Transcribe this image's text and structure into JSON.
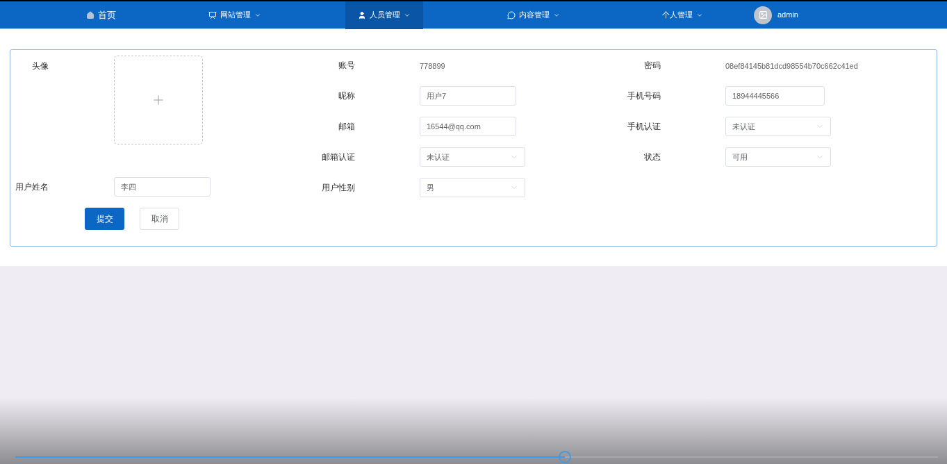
{
  "nav": {
    "items": [
      {
        "label": "首页",
        "dropdown": false,
        "selected": false
      },
      {
        "label": "网站管理",
        "dropdown": true,
        "selected": false
      },
      {
        "label": "人员管理",
        "dropdown": true,
        "selected": true
      },
      {
        "label": "内容管理",
        "dropdown": true,
        "selected": false
      },
      {
        "label": "个人管理",
        "dropdown": true,
        "selected": false
      }
    ],
    "user": {
      "name": "admin"
    }
  },
  "form": {
    "avatar": {
      "label": "头像"
    },
    "left": [
      {
        "label": "用户姓名",
        "kind": "input",
        "value": "李四"
      }
    ],
    "middle": [
      {
        "label": "账号",
        "kind": "text",
        "value": "778899"
      },
      {
        "label": "昵称",
        "kind": "input",
        "value": "用户7"
      },
      {
        "label": "邮箱",
        "kind": "input",
        "value": "16544@qq.com"
      },
      {
        "label": "邮箱认证",
        "kind": "select",
        "value": "未认证"
      },
      {
        "label": "用户性别",
        "kind": "select",
        "value": "男"
      }
    ],
    "right": [
      {
        "label": "密码",
        "kind": "text",
        "value": "08ef84145b81dcd98554b70c662c41ed"
      },
      {
        "label": "手机号码",
        "kind": "input",
        "value": "18944445566"
      },
      {
        "label": "手机认证",
        "kind": "select",
        "value": "未认证"
      },
      {
        "label": "状态",
        "kind": "select",
        "value": "可用"
      }
    ],
    "buttons": [
      {
        "label": "提交",
        "kind": "primary"
      },
      {
        "label": "取消",
        "kind": "default"
      }
    ]
  },
  "video_progress": {
    "level": 0.596
  }
}
